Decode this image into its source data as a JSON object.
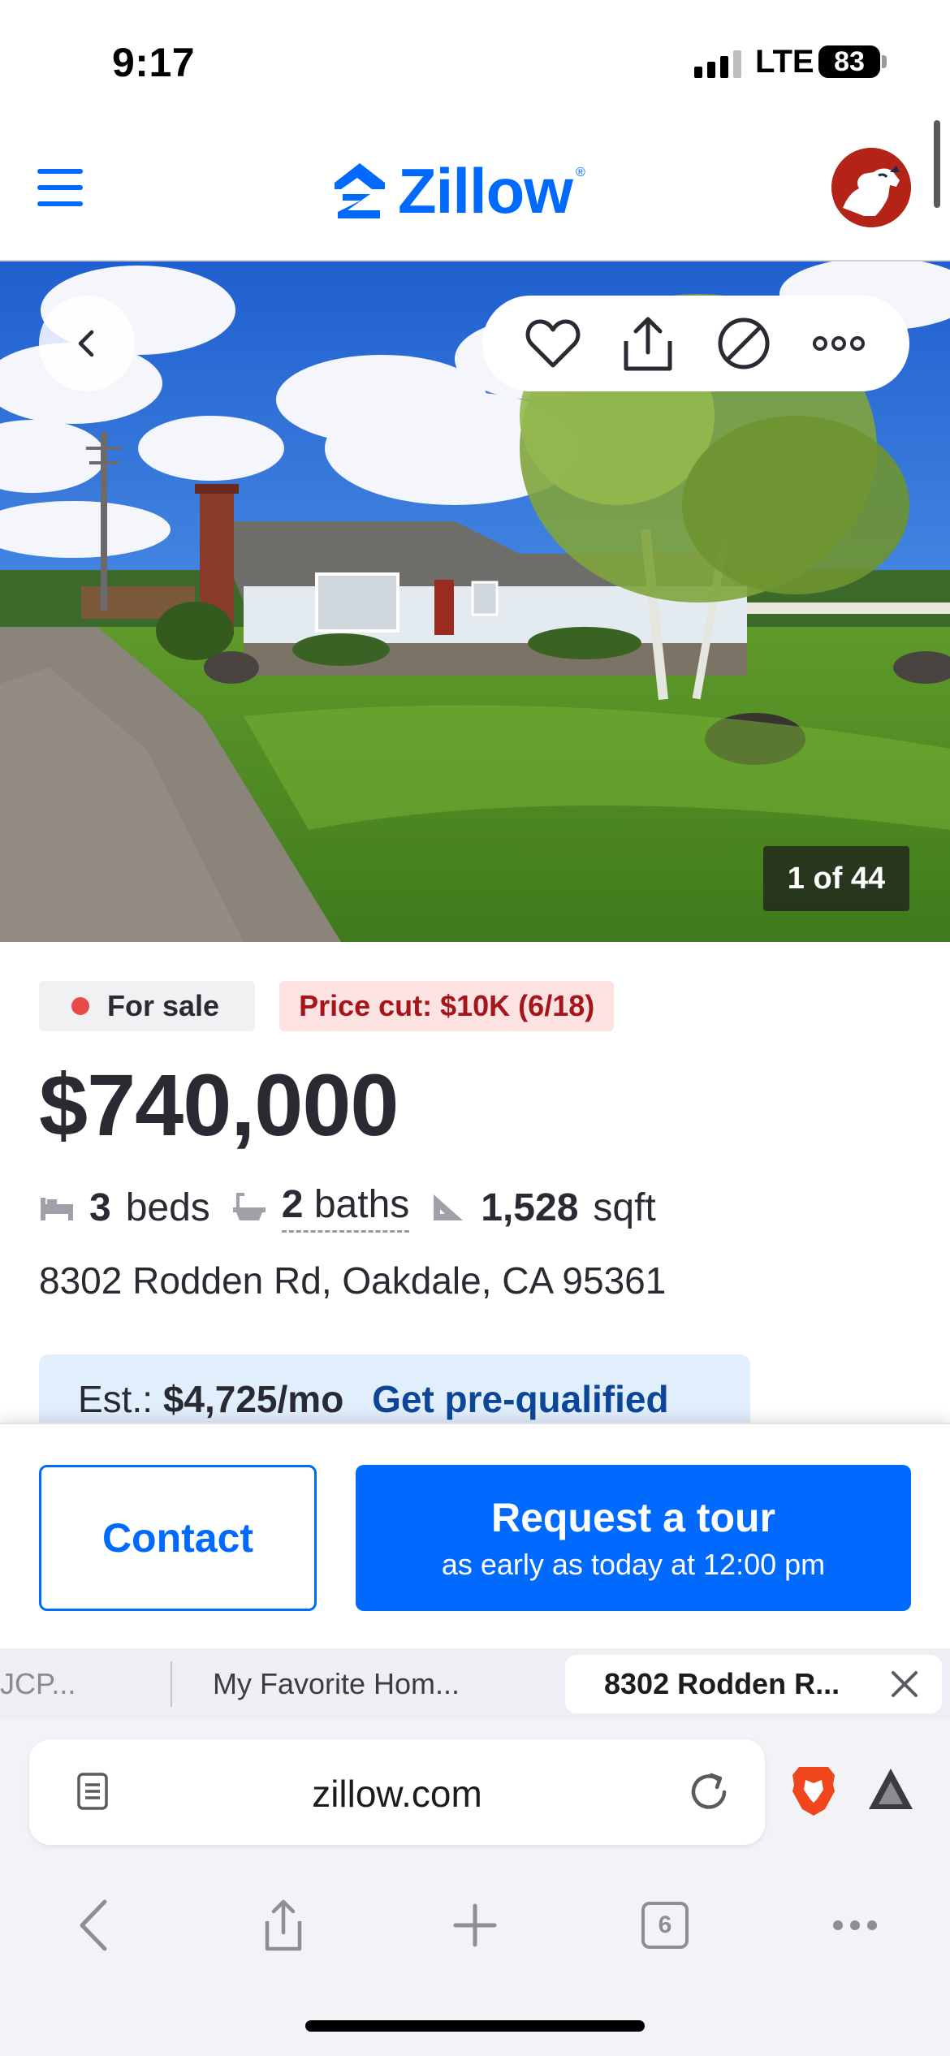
{
  "status_bar": {
    "time": "9:17",
    "network": "LTE",
    "battery": "83"
  },
  "header": {
    "logo_text": "Zillow",
    "logo_reg": "®"
  },
  "hero": {
    "photo_counter": "1 of 44"
  },
  "listing": {
    "status_badge": "For sale",
    "price_cut_badge": "Price cut: $10K (6/18)",
    "price": "$740,000",
    "beds_value": "3",
    "beds_label": "beds",
    "baths_value": "2",
    "baths_label": "baths",
    "sqft_value": "1,528",
    "sqft_label": "sqft",
    "address": "8302 Rodden Rd, Oakdale, CA 95361",
    "est_label": "Est.:",
    "est_payment": "$4,725/mo",
    "prequal_link": "Get pre-qualified"
  },
  "cta": {
    "contact_label": "Contact",
    "tour_label": "Request a tour",
    "tour_sublabel": "as early as today at 12:00 pm"
  },
  "browser": {
    "tabs": [
      {
        "title": "JCP..."
      },
      {
        "title": "My Favorite Hom..."
      },
      {
        "title": "8302 Rodden R..."
      }
    ],
    "url": "zillow.com",
    "tab_count": "6"
  },
  "colors": {
    "brand_blue": "#006aff",
    "sale_dot": "#e84a4a",
    "price_cut_bg": "#fde2e2",
    "price_cut_text": "#a6151b"
  }
}
